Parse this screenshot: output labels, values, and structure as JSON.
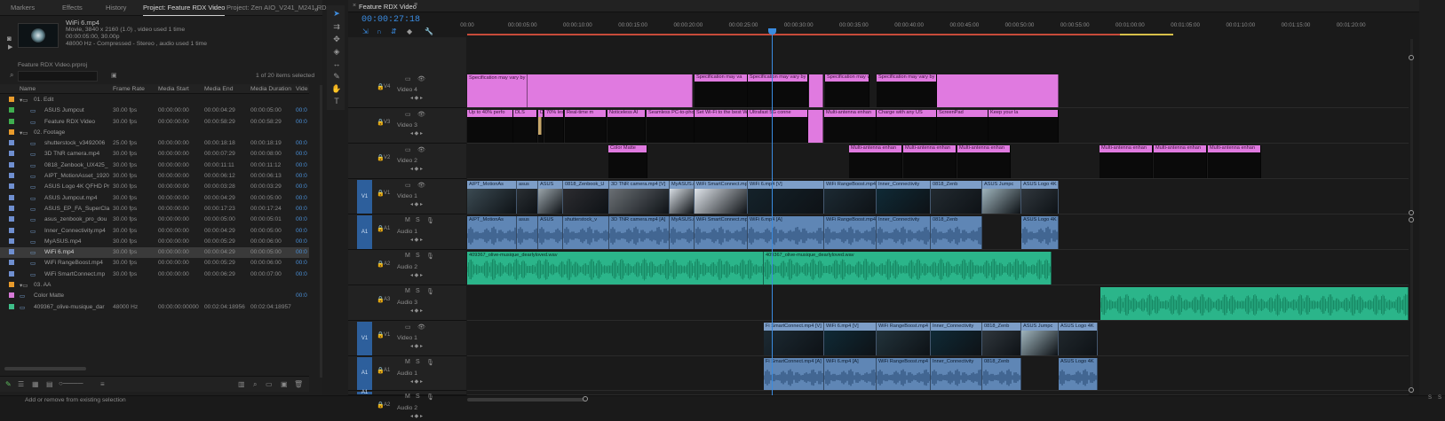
{
  "project_panel": {
    "tabs": [
      "Markers",
      "Effects",
      "History",
      "Project: Feature RDX Video",
      "Project: Zen AIO_V241_M241 RDX"
    ],
    "active_tab": 3,
    "clip_info": {
      "name": "WiFi 6.mp4",
      "line1": "Movie, 3840 x 2160 (1.0)  , video used 1 time",
      "line2": "00:00:05:00, 30.00p",
      "line3": "48000 Hz - Compressed - Stereo  , audio used 1 time"
    },
    "bin_path": "Feature RDX Video.prproj",
    "items_selected": "1 of 20 items selected",
    "columns": [
      "Name",
      "Frame Rate",
      "Media Start",
      "Media End",
      "Media Duration",
      "Vide"
    ],
    "rows": [
      {
        "name": "01. Edit",
        "color": "#e89b2c",
        "indent": 1,
        "folder": true,
        "fps": "",
        "start": "",
        "end": "",
        "dur": "",
        "vid": "",
        "sel": false
      },
      {
        "name": "ASUS Jumpcut",
        "color": "#3fae4f",
        "indent": 3,
        "folder": false,
        "fps": "30.00 fps",
        "start": "00:00:00:00",
        "end": "00:00:04:29",
        "dur": "00:00:05:00",
        "vid": "00:0",
        "sel": false
      },
      {
        "name": "Feature RDX Video",
        "color": "#3fae4f",
        "indent": 3,
        "folder": false,
        "fps": "30.00 fps",
        "start": "00:00:00:00",
        "end": "00:00:58:29",
        "dur": "00:00:58:29",
        "vid": "00:0",
        "sel": false
      },
      {
        "name": "02. Footage",
        "color": "#e89b2c",
        "indent": 1,
        "folder": true,
        "fps": "",
        "start": "",
        "end": "",
        "dur": "",
        "vid": "",
        "sel": false
      },
      {
        "name": "shutterstock_v3492006",
        "color": "#6f8fd0",
        "indent": 3,
        "folder": false,
        "fps": "25.00 fps",
        "start": "00:00:00:00",
        "end": "00:00:18:18",
        "dur": "00:00:18:19",
        "vid": "00:0",
        "sel": false
      },
      {
        "name": "3D TNR camera.mp4",
        "color": "#6f8fd0",
        "indent": 3,
        "folder": false,
        "fps": "30.00 fps",
        "start": "00:00:00:00",
        "end": "00:00:07:29",
        "dur": "00:00:08:00",
        "vid": "00:0",
        "sel": false
      },
      {
        "name": "0818_Zenbook_UX425_",
        "color": "#6f8fd0",
        "indent": 3,
        "folder": false,
        "fps": "30.00 fps",
        "start": "00:00:00:00",
        "end": "00:00:11:11",
        "dur": "00:00:11:12",
        "vid": "00:0",
        "sel": false
      },
      {
        "name": "AIPT_MotionAsset_1920",
        "color": "#6f8fd0",
        "indent": 3,
        "folder": false,
        "fps": "30.00 fps",
        "start": "00:00:00:00",
        "end": "00:00:06:12",
        "dur": "00:00:06:13",
        "vid": "00:0",
        "sel": false
      },
      {
        "name": "ASUS Logo 4K QFHD Pr",
        "color": "#6f8fd0",
        "indent": 3,
        "folder": false,
        "fps": "30.00 fps",
        "start": "00:00:00:00",
        "end": "00:00:03:28",
        "dur": "00:00:03:29",
        "vid": "00:0",
        "sel": false
      },
      {
        "name": "ASUS Jumpcut.mp4",
        "color": "#6f8fd0",
        "indent": 3,
        "folder": false,
        "fps": "30.00 fps",
        "start": "00:00:00:00",
        "end": "00:00:04:29",
        "dur": "00:00:05:00",
        "vid": "00:0",
        "sel": false
      },
      {
        "name": "ASUS_EP_FA_SuperCla",
        "color": "#6f8fd0",
        "indent": 3,
        "folder": false,
        "fps": "30.00 fps",
        "start": "00:00:00:00",
        "end": "00:00:17:23",
        "dur": "00:00:17:24",
        "vid": "00:0",
        "sel": false
      },
      {
        "name": "asus_zenbook_pro_dou",
        "color": "#6f8fd0",
        "indent": 3,
        "folder": false,
        "fps": "30.00 fps",
        "start": "00:00:00:00",
        "end": "00:00:05:00",
        "dur": "00:00:05:01",
        "vid": "00:0",
        "sel": false
      },
      {
        "name": "Inner_Connectivity.mp4",
        "color": "#6f8fd0",
        "indent": 3,
        "folder": false,
        "fps": "30.00 fps",
        "start": "00:00:00:00",
        "end": "00:00:04:29",
        "dur": "00:00:05:00",
        "vid": "00:0",
        "sel": false
      },
      {
        "name": "MyASUS.mp4",
        "color": "#6f8fd0",
        "indent": 3,
        "folder": false,
        "fps": "30.00 fps",
        "start": "00:00:00:00",
        "end": "00:00:05:29",
        "dur": "00:00:06:00",
        "vid": "00:0",
        "sel": false
      },
      {
        "name": "WiFi 6.mp4",
        "color": "#6f8fd0",
        "indent": 3,
        "folder": false,
        "fps": "30.00 fps",
        "start": "00:00:00:00",
        "end": "00:00:04:29",
        "dur": "00:00:05:00",
        "vid": "00:0",
        "sel": true
      },
      {
        "name": "WiFi RangeBoost.mp4",
        "color": "#6f8fd0",
        "indent": 3,
        "folder": false,
        "fps": "30.00 fps",
        "start": "00:00:00:00",
        "end": "00:00:05:29",
        "dur": "00:00:06:00",
        "vid": "00:0",
        "sel": false
      },
      {
        "name": "WiFi SmartConnect.mp",
        "color": "#6f8fd0",
        "indent": 3,
        "folder": false,
        "fps": "30.00 fps",
        "start": "00:00:00:00",
        "end": "00:00:06:29",
        "dur": "00:00:07:00",
        "vid": "00:0",
        "sel": false
      },
      {
        "name": "03. AA",
        "color": "#e89b2c",
        "indent": 1,
        "folder": true,
        "fps": "",
        "start": "",
        "end": "",
        "dur": "",
        "vid": "",
        "sel": false
      },
      {
        "name": "Color Matte",
        "color": "#d77ad7",
        "indent": 1,
        "folder": false,
        "fps": "",
        "start": "",
        "end": "",
        "dur": "",
        "vid": "00:0",
        "sel": false
      },
      {
        "name": "409367_olive-musique_dar",
        "color": "#3fbf8a",
        "indent": 1,
        "folder": false,
        "fps": "48000 Hz",
        "start": "00:00:00:00000",
        "end": "00:02:04:18956",
        "dur": "00:02:04:18957",
        "vid": "",
        "sel": false
      }
    ],
    "status": "Add or remove from existing selection"
  },
  "timeline": {
    "title": "Feature RDX Video",
    "timecode": "00:00:27:18",
    "ruler": [
      "00:00",
      "00:00:05:00",
      "00:00:10:00",
      "00:00:15:00",
      "00:00:20:00",
      "00:00:25:00",
      "00:00:30:00",
      "00:00:35:00",
      "00:00:40:00",
      "00:00:45:00",
      "00:00:50:00",
      "00:00:55:00",
      "00:01:00:00",
      "00:01:05:00",
      "00:01:10:00",
      "00:01:15:00",
      "00:01:20:00"
    ],
    "tracks": [
      {
        "id": "V4",
        "label": "Video 4",
        "kind": "video",
        "tag": ""
      },
      {
        "id": "V3",
        "label": "Video 3",
        "kind": "video",
        "tag": ""
      },
      {
        "id": "V2",
        "label": "Video 2",
        "kind": "video",
        "tag": ""
      },
      {
        "id": "V1",
        "label": "Video 1",
        "kind": "video",
        "tag": "V1"
      },
      {
        "id": "A1",
        "label": "Audio 1",
        "kind": "audio",
        "tag": "A1"
      },
      {
        "id": "A2",
        "label": "Audio 2",
        "kind": "audio",
        "tag": ""
      },
      {
        "id": "A3",
        "label": "Audio 3",
        "kind": "audio",
        "tag": ""
      },
      {
        "id": "V1",
        "label": "Video 1",
        "kind": "video",
        "tag": "V1"
      },
      {
        "id": "A1",
        "label": "Audio 1",
        "kind": "audio",
        "tag": "A1"
      },
      {
        "id": "A2",
        "label": "Audio 2",
        "kind": "audio",
        "tag": "A1"
      }
    ],
    "clips": {
      "v4": [
        "Specification may vary by model",
        "Specification may va",
        "Specification may vary by model",
        "Specification may va",
        "Specification may vary by model"
      ],
      "v3": [
        "Up to 40% perfo",
        "DLS",
        "DLS",
        "70% less dist",
        "Real-time m",
        "Noticeless AI",
        "Seamless PC-to-phon",
        "Set Wi-Fi to the best Wi-Fi access p",
        "Ultrafast 5G conne",
        "Multi-antenna enhan",
        "Charge with any US",
        "ScreenPad",
        "Keep your la"
      ],
      "v2": [
        "Color Matte",
        "Multi-antenna enhan",
        "Multi-antenna enhan",
        "Multi-antenna enhan",
        "Multi-antenna enhan",
        "Multi-antenna enhan",
        "Multi-antenna enhan"
      ],
      "v1": [
        "AIPT_MotionAs",
        "asus",
        "ASUS",
        "0818_Zenbook_U",
        "3D TNR camera.mp4 [V]",
        "MyASUS.mp4 [V]",
        "WiFi SmartConnect.mp4 [V]",
        "WiFi 6.mp4 [V]",
        "WiFi RangeBoost.mp4",
        "Inner_Connectivity",
        "0818_Zenb",
        "ASUS Jumpc",
        "ASUS Logo 4K"
      ],
      "a1": [
        "AIPT_MotionAs",
        "asus",
        "ASUS",
        "shutterstock_v",
        "3D TNR camera.mp4 [A]",
        "MyASUS.mp4 [A]",
        "WiFi SmartConnect.mp4 [A]",
        "WiFi 6.mp4 [A]",
        "WiFi RangeBoost.mp4",
        "Inner_Connectivity",
        "0818_Zenb",
        "ASUS Logo 4K"
      ],
      "a2": [
        "409367_olive-musique_dearlyloved.wav",
        "409367_olive-musique_dearlyloved.wav"
      ],
      "v1b": [
        "Fi SmartConnect.mp4 [V]",
        "WiFi 6.mp4 [V]",
        "WiFi RangeBoost.mp4",
        "Inner_Connectivity",
        "0818_Zenb",
        "ASUS Jumpc",
        "ASUS Logo 4K"
      ],
      "a1b": [
        "Fi SmartConnect.mp4 [A]",
        "WiFi 6.mp4 [A]",
        "WiFi RangeBoost.mp4",
        "Inner_Connectivity",
        "0818_Zenb",
        "ASUS Logo 4K"
      ]
    }
  },
  "colors": {
    "accent": "#3a8be0",
    "pink_clip": "#e07ae0",
    "video_clip": "#7d9ec8",
    "audio_clip": "#5f86b5",
    "music_clip": "#2bb58a",
    "work_area_red": "#c74b3a"
  },
  "icons": [
    "selection-tool-icon",
    "track-select-icon",
    "ripple-edit-icon",
    "razor-icon",
    "slip-icon",
    "pen-icon",
    "hand-icon",
    "type-icon",
    "lock-icon",
    "eye-icon",
    "mute-icon",
    "solo-icon",
    "mic-icon",
    "search-icon",
    "new-bin-icon",
    "list-view-icon",
    "icon-view-icon",
    "trash-icon",
    "snap-icon",
    "marker-icon",
    "wrench-icon"
  ]
}
